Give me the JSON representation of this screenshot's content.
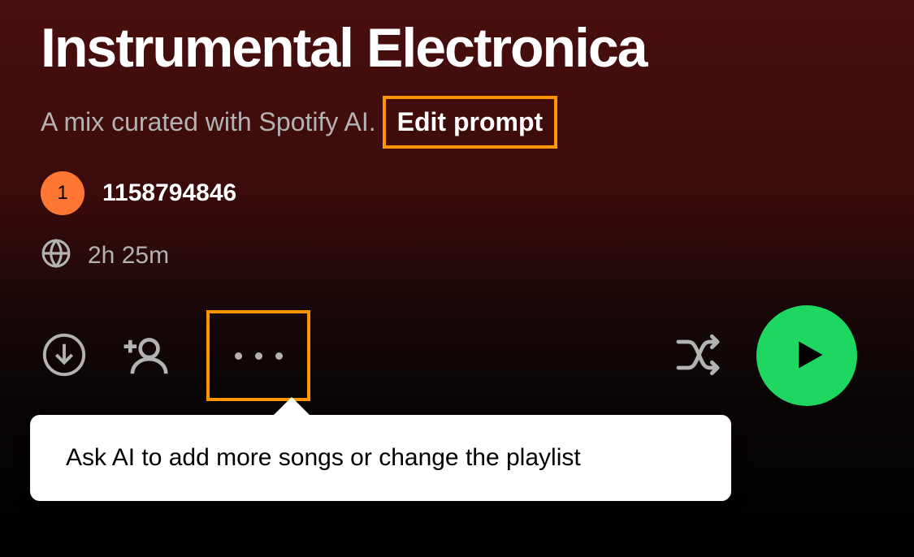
{
  "playlist": {
    "title": "Instrumental Electronica",
    "subtitle": "A mix curated with Spotify AI.",
    "edit_prompt_label": "Edit prompt",
    "duration": "2h 25m"
  },
  "user": {
    "avatar_initial": "1",
    "username": "1158794846"
  },
  "tooltip": {
    "text": "Ask AI to add more songs or change the playlist"
  },
  "colors": {
    "accent_green": "#1ed760",
    "highlight_orange": "#ff9500",
    "avatar_bg": "#ff7733"
  }
}
